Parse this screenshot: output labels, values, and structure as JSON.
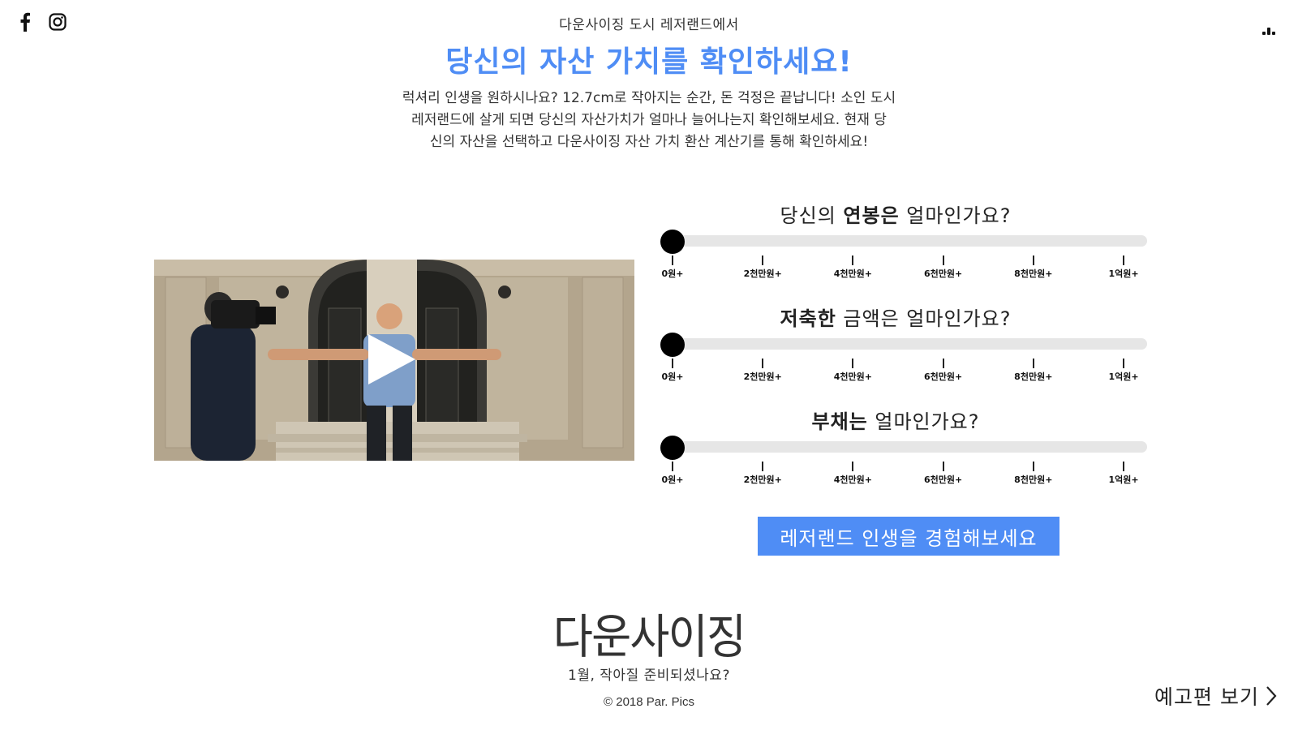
{
  "social": {
    "icons": [
      "facebook-icon",
      "instagram-icon"
    ]
  },
  "menu": {
    "icon": "menu-dots-icon"
  },
  "header": {
    "subtitle": "다운사이징 도시 레저랜드에서",
    "title": "당신의 자산 가치를 확인하세요!"
  },
  "intro": {
    "lines": [
      "럭셔리 인생을 원하시나요? 12.7cm로 작아지는 순간, 돈 걱정은 끝납니다! 소인 도시",
      "레저랜드에 살게 되면 당신의 자산가치가 얼마나 늘어나는지 확인해보세요. 현재 당",
      "신의 자산을 선택하고 다운사이징 자산 가치 환산 계산기를 통해 확인하세요!"
    ]
  },
  "video": {
    "play_icon": "play-icon"
  },
  "questions": [
    {
      "pre": "당신의 ",
      "bold": "연봉은",
      "post": " 얼마인가요?",
      "value": 0
    },
    {
      "pre": "",
      "bold": "저축한",
      "post": " 금액은 얼마인가요?",
      "value": 0
    },
    {
      "pre": "",
      "bold": "부채는",
      "post": " 얼마인가요?",
      "value": 0
    }
  ],
  "scale_labels": [
    "0원+",
    "2천만원+",
    "4천만원+",
    "6천만원+",
    "8천만원+",
    "1억원+"
  ],
  "cta": {
    "label": "레저랜드 인생을 경험해보세요"
  },
  "footer": {
    "logo_text": "다운사이징",
    "tagline": "1월, 작아질 준비되셨나요?",
    "copyright": "© 2018 Par. Pics"
  },
  "trailer": {
    "label": "예고편 보기",
    "icon": "chevron-right-icon"
  },
  "colors": {
    "accent": "#4f8df5",
    "track": "#e6e6e6",
    "knob": "#000000"
  }
}
